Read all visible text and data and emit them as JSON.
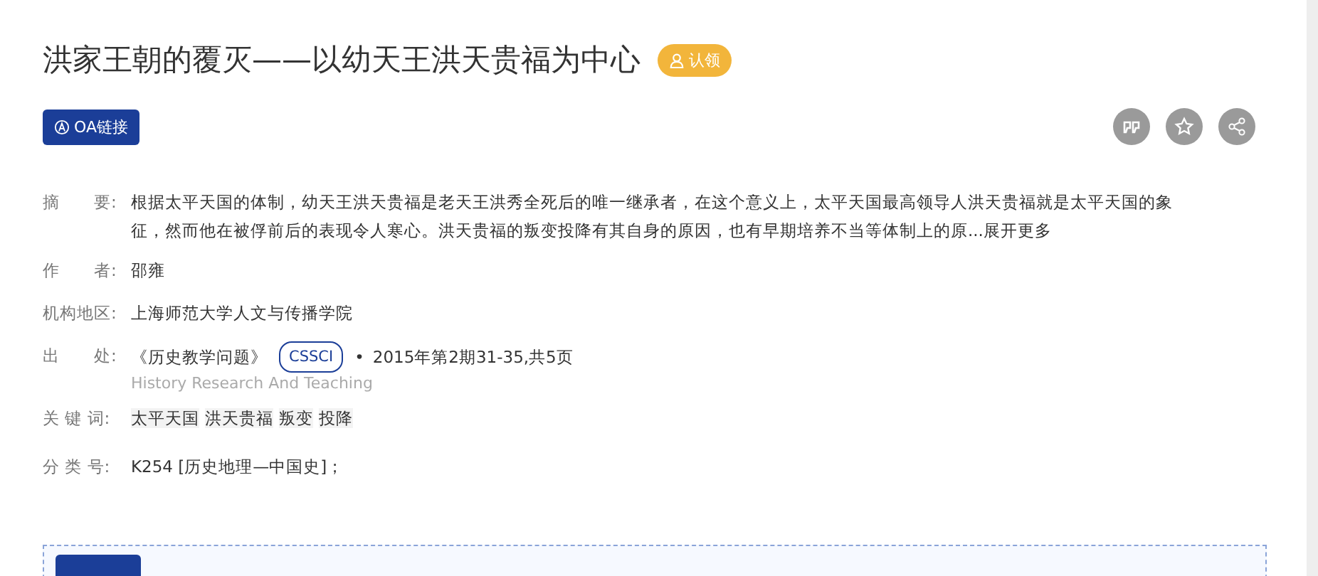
{
  "title": "洪家王朝的覆灭——以幼天王洪天贵福为中心",
  "claim_badge": "认领",
  "oa_button": "OA链接",
  "meta": [
    {
      "kind": "abstract",
      "label": "摘　　要:",
      "text": "根据太平天国的体制，幼天王洪天贵福是老天王洪秀全死后的唯一继承者，在这个意义上，太平天国最高领导人洪天贵福就是太平天国的象征，然而他在被俘前后的表现令人寒心。洪天贵福的叛变投降有其自身的原因，也有早期培养不当等体制上的原...",
      "more": "展开更多"
    },
    {
      "kind": "text",
      "label": "作　　者:",
      "text": "邵雍"
    },
    {
      "kind": "text",
      "label": "机构地区:",
      "text": "上海师范大学人文与传播学院"
    },
    {
      "kind": "source",
      "label": "出　　处:",
      "journal": "《历史教学问题》",
      "tag": "CSSCI",
      "dot": "•",
      "issue": "2015年第2期31-35,共5页",
      "english": "History Research And Teaching"
    },
    {
      "kind": "keywords",
      "label": "关 键 词:",
      "keywords": [
        "太平天国",
        "洪天贵福",
        "叛变",
        "投降"
      ]
    },
    {
      "kind": "text",
      "label": "分 类 号:",
      "text": "K254 [历史地理—中国史]；"
    }
  ]
}
